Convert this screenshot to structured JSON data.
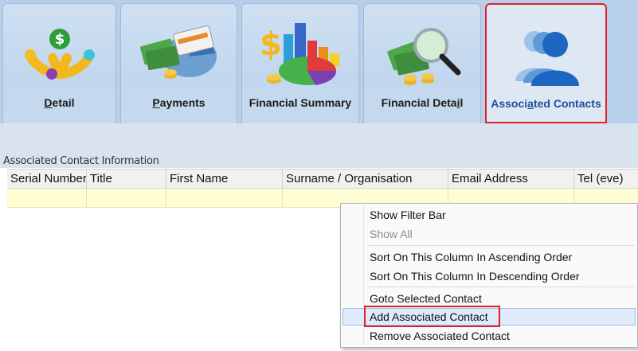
{
  "tabs": [
    {
      "label_pre": "",
      "label_ul": "D",
      "label_post": "etail",
      "icon": "hand-money-icon"
    },
    {
      "label_pre": "",
      "label_ul": "P",
      "label_post": "ayments",
      "icon": "credit-card-cash-icon"
    },
    {
      "label_pre": "Financial Summary",
      "label_ul": "",
      "label_post": "",
      "icon": "financial-chart-icon"
    },
    {
      "label_pre": "Financial Deta",
      "label_ul": "i",
      "label_post": "l",
      "icon": "magnifier-cash-icon"
    },
    {
      "label_pre": "Associ",
      "label_ul": "a",
      "label_post": "ted Contacts",
      "icon": "people-contacts-icon"
    }
  ],
  "section": {
    "title": "Associated Contact Information"
  },
  "grid": {
    "columns": [
      "Serial Number",
      "Title",
      "First Name",
      "Surname / Organisation",
      "Email Address",
      "Tel (eve)"
    ]
  },
  "context_menu": {
    "items": [
      {
        "label": "Show Filter Bar",
        "disabled": false
      },
      {
        "label": "Show All",
        "disabled": true
      },
      {
        "label": "Sort On This Column In Ascending Order",
        "disabled": false
      },
      {
        "label": "Sort On This Column In Descending Order",
        "disabled": false
      },
      {
        "label": "Goto Selected Contact",
        "disabled": false
      },
      {
        "label": "Add Associated Contact",
        "disabled": false,
        "hovered": true
      },
      {
        "label": "Remove Associated Contact",
        "disabled": false
      }
    ]
  },
  "colors": {
    "ribbon": "#b7cfe8",
    "active_label": "#1d4f9c",
    "highlight_border": "#e0202a",
    "new_row": "#fefdd4"
  }
}
